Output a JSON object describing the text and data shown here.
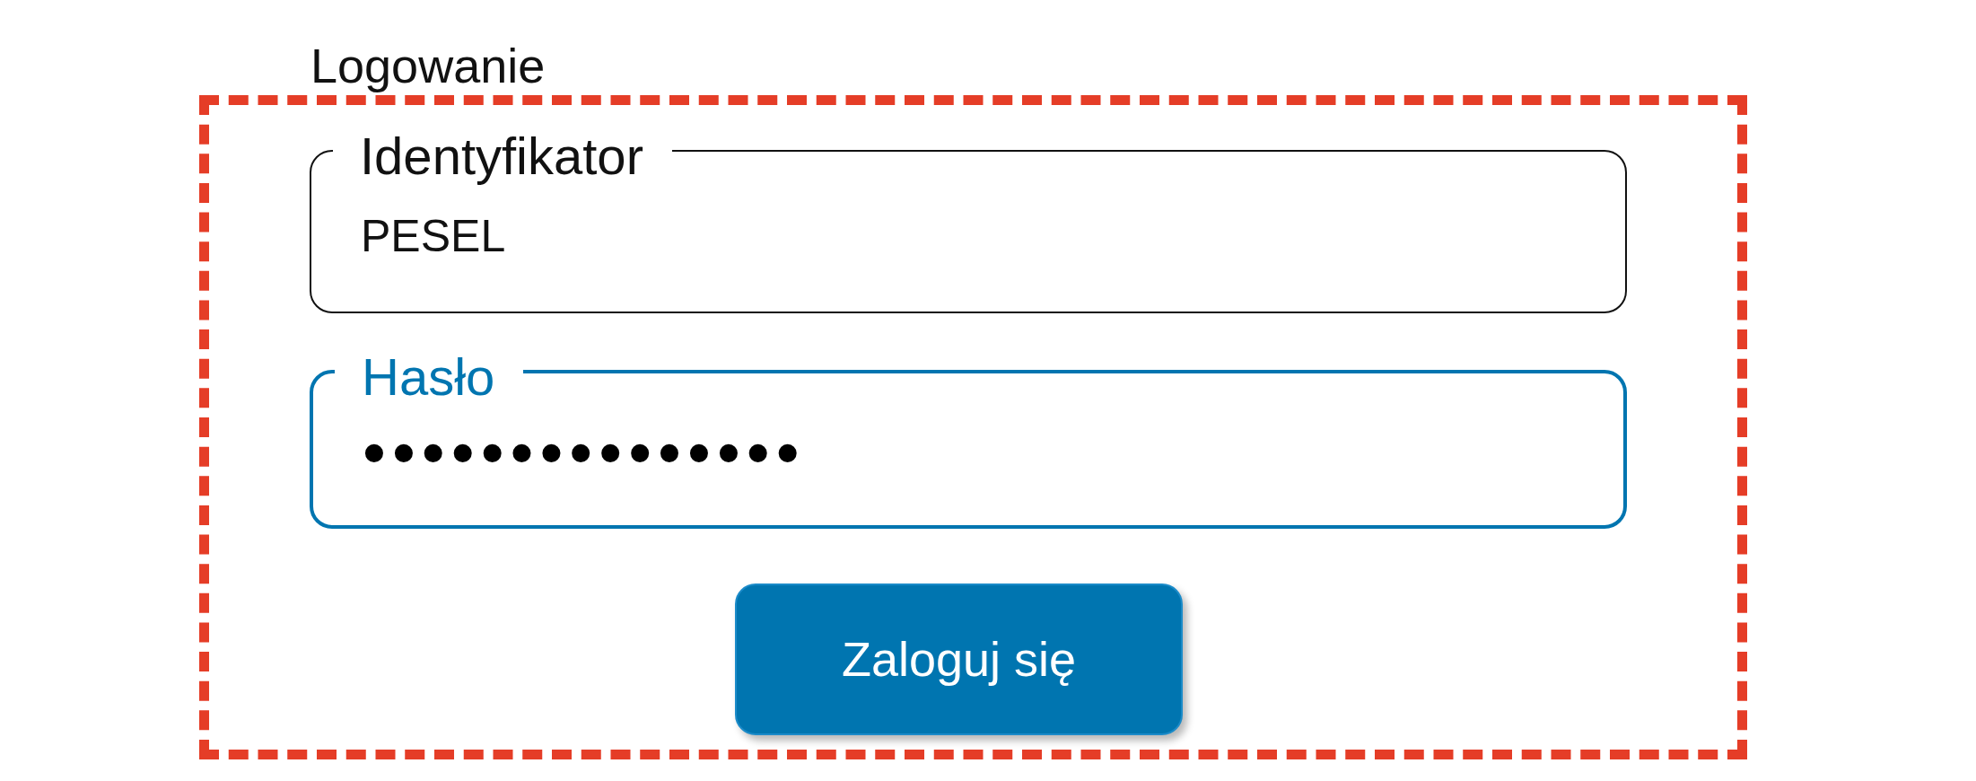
{
  "title": "Logowanie",
  "fields": [
    {
      "kind": "text",
      "label": "Identyfikator",
      "value": "PESEL",
      "focused": false
    },
    {
      "kind": "password",
      "label": "Hasło",
      "value": "•••••••••••••••",
      "focused": true
    }
  ],
  "button": {
    "label": "Zaloguj się"
  }
}
